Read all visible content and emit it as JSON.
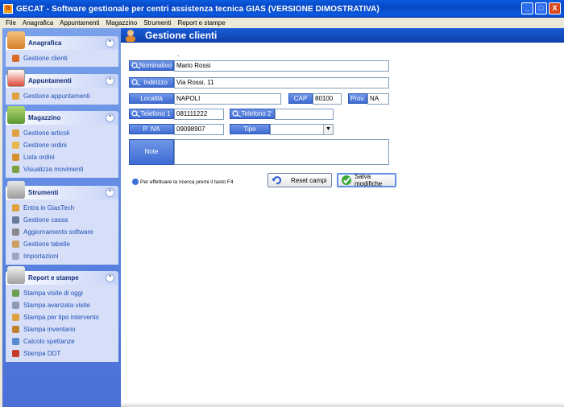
{
  "window": {
    "title": "GECAT - Software gestionale per centri assistenza tecnica GIAS (VERSIONE DIMOSTRATIVA)",
    "minimize": "_",
    "maximize": "□",
    "close": "X"
  },
  "menu": [
    "File",
    "Anagrafica",
    "Appuntamenti",
    "Magazzino",
    "Strumenti",
    "Report e stampe"
  ],
  "sidebar": {
    "groups": [
      {
        "title": "Anagrafica",
        "collapse": "⌃",
        "items": [
          "Gestione clienti"
        ]
      },
      {
        "title": "Appuntamenti",
        "collapse": "⌃",
        "items": [
          "Gestione appuntamenti"
        ]
      },
      {
        "title": "Magazzino",
        "collapse": "⌃",
        "items": [
          "Gestione articoli",
          "Gestione ordini",
          "Lista ordini",
          "Visualizza movimenti"
        ]
      },
      {
        "title": "Strumenti",
        "collapse": "⌃",
        "items": [
          "Entra in GiasTech",
          "Gestione cassa",
          "Aggiornamento software",
          "Gestione tabelle",
          "Importazioni"
        ]
      },
      {
        "title": "Report e stampe",
        "collapse": "⌃",
        "items": [
          "Stampa visite di oggi",
          "Stampa avanzata visite",
          "Stampa per tipo intervento",
          "Stampa inventario",
          "Calcolo spettanze",
          "Stampa DDT"
        ]
      }
    ]
  },
  "main": {
    "title": "Gestione clienti",
    "dot": ".",
    "labels": {
      "nominativo": "Nominativo",
      "indirizzo": "Indirizzo",
      "localita": "Località",
      "cap": "CAP",
      "prov": "Prov.",
      "telefono1": "Telefono 1",
      "telefono2": "Telefono 2",
      "piva": "P. IVA",
      "tipo": "Tipo",
      "note": "Note"
    },
    "values": {
      "nominativo": "Mario Rossi",
      "indirizzo": "Via Rossi, 11",
      "localita": "NAPOLI",
      "cap": "80100",
      "prov": "NA",
      "telefono1": "081111222",
      "telefono2": "",
      "piva": "09098907",
      "tipo": "",
      "note": ""
    },
    "tipo_arrow": "▼",
    "hint": "Per effettuare la ricerca premi il tasto F4",
    "buttons": {
      "reset": "Reset campi",
      "salva": "Salva modifiche"
    }
  }
}
